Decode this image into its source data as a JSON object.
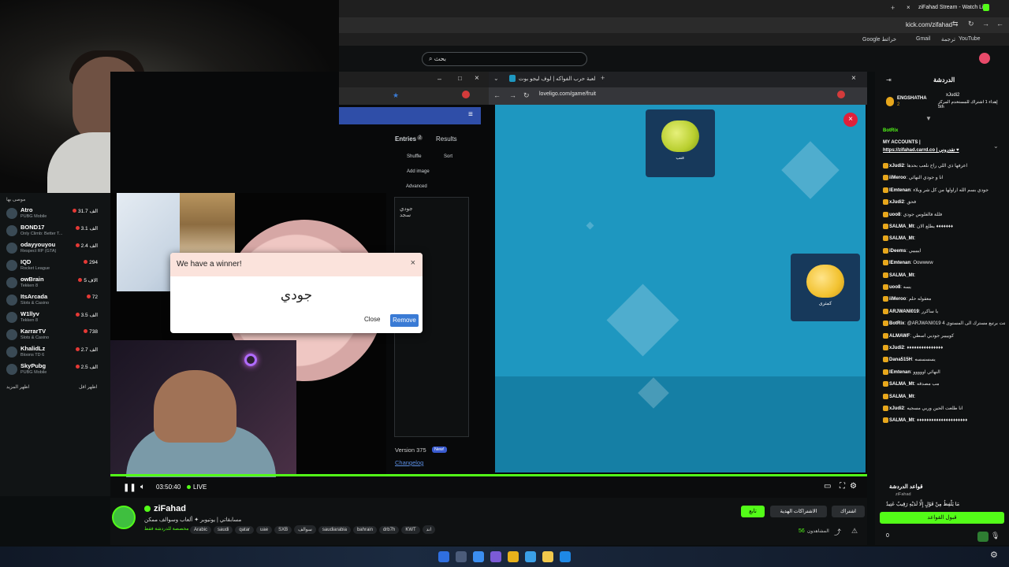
{
  "browser": {
    "tab_title": "ziFahad Stream - Watch Li...",
    "url": "kick.com/zifahad",
    "bookmarks": [
      "Google خرائط",
      "Gmail",
      "ترجمة",
      "YouTube"
    ]
  },
  "kick_header": {
    "search_placeholder": "بحث"
  },
  "left_sidebar": {
    "header": "موصى بها",
    "channels": [
      {
        "name": "Atro",
        "game": "PUBG Mobile",
        "viewers": "31.7 الف"
      },
      {
        "name": "BOND17",
        "game": "Only Climb: Better T...",
        "viewers": "3.1 الف"
      },
      {
        "name": "odayyouyou",
        "game": "Respect RP (GTA)",
        "viewers": "2.4 الف"
      },
      {
        "name": "IQD",
        "game": "Rocket League",
        "viewers": "294"
      },
      {
        "name": "owBrain",
        "game": "Tekken 8",
        "viewers": "5 الاف"
      },
      {
        "name": "ItsArcada",
        "game": "Slots & Casino",
        "viewers": "72"
      },
      {
        "name": "W1llyv",
        "game": "Tekken 8",
        "viewers": "3.5 الف"
      },
      {
        "name": "KarrarTV",
        "game": "Slots & Casino",
        "viewers": "738"
      },
      {
        "name": "KhalidLz",
        "game": "Bloons TD 6",
        "viewers": "2.7 الف"
      },
      {
        "name": "SkyPubg",
        "game": "PUBG Mobile",
        "viewers": "2.5 الف"
      }
    ],
    "show_more": "اظهر المزيد",
    "show_less": "اظهر اقل"
  },
  "wheel_app": {
    "dialog_title": "We have a winner!",
    "winner": "جودي",
    "close_label": "Close",
    "remove_label": "Remove",
    "entries_tab": "Entries",
    "entries_count": "2",
    "results_tab": "Results",
    "shuffle": "Shuffle",
    "sort": "Sort",
    "add_image": "Add image",
    "advanced": "Advanced",
    "entry_1": "جودي",
    "entry_2": "سجد",
    "version": "Version 375",
    "new_badge": "New!",
    "changelog": "Changelog"
  },
  "game_window": {
    "tab_title": "لعبة حرب الفواكه | لوف ليجو بوت",
    "url": "loveligo.com/game/fruit",
    "card_1_label": "عنب",
    "card_2_label": "كمثرى"
  },
  "player": {
    "time": "03:50:40",
    "live": "LIVE"
  },
  "channel": {
    "name": "ziFahad",
    "title": "مسابقاتي | يوتيوبر ✦ ألعاب وسوالف ممكن",
    "category": "مخصصة للدردشة فقط",
    "tags": [
      "Arabic",
      "saudi",
      "qatar",
      "uae",
      "SXB",
      "سوالف",
      "saudiarabia",
      "bahrain",
      "drb7h",
      "KWT",
      "اند"
    ],
    "follow": "تابع",
    "subscribe": "الاشتراكات الهدية",
    "share": "اشتراك",
    "viewers_label": "المشاهدون",
    "viewers": "56"
  },
  "chat": {
    "title": "الدردشة",
    "pinned_user": "ENGSHATHA",
    "pinned_count": "2",
    "pinned_msg_user": "xJudi2",
    "pinned_msg": "إهداء 1 اشتراك للمستخدم المركز 5th",
    "bot_user": "BotRix",
    "bot_msg_1": "MY ACCOUNTS |",
    "bot_msg_2": "https://zifahad.carrd.co | تقدروني ♥",
    "messages": [
      {
        "user": "xJudi2",
        "text": "اعرفها ذي اللي راح نلعب بحدها"
      },
      {
        "user": "iiMeroo",
        "text": "انا و جودي النهائي"
      },
      {
        "user": "lEmtenan",
        "text": "جودي بسم الله اراولها من كل شر وبلاء"
      },
      {
        "user": "xJudi2",
        "text": "فحق"
      },
      {
        "user": "uoo8",
        "text": "فللة فالغلوس جودي"
      },
      {
        "user": "SALMA_Mt",
        "text": "يطلع الان ♦♦♦♦♦♦♦"
      },
      {
        "user": "SALMA_Mt",
        "text": ""
      },
      {
        "user": "iDeems",
        "text": "ايييييي"
      },
      {
        "user": "lEmtenan",
        "text": "Oowwww"
      },
      {
        "user": "SALMA_Mt",
        "text": ""
      },
      {
        "user": "uoo8",
        "text": "يسه"
      },
      {
        "user": "iiMeroo",
        "text": "معقوله حلم"
      },
      {
        "user": "ARJWANI019",
        "text": "يا ساكرر"
      },
      {
        "user": "BotRix",
        "text": "@ARJWANI019 فتت برتبع مسترك الى المستوى 4"
      },
      {
        "user": "ALMAWF",
        "text": "كويييير جوديي اسطي"
      },
      {
        "user": "xJudi2",
        "text": "♦♦♦♦♦♦♦♦♦♦♦♦♦♦♦"
      },
      {
        "user": "Dana515H",
        "text": "يسسسسه"
      },
      {
        "user": "lEmtenan",
        "text": "النهائي اووووو"
      },
      {
        "user": "SALMA_Mt",
        "text": "مب مصدقه"
      },
      {
        "user": "SALMA_Mt",
        "text": ""
      },
      {
        "user": "xJudi2",
        "text": "انا طلعت الحين وربي مسجيه"
      },
      {
        "user": "SALMA_Mt",
        "text": "♦♦♦♦♦♦♦♦♦♦♦♦♦♦♦♦♦♦♦♦♦"
      }
    ],
    "rules_title": "قواعد الدردشة",
    "rules_user": "ziFahad",
    "rules_text": "مَا يَلْفِظُ مِنْ قَوْلٍ إِلَّا لَدَيْهِ رَقِيبٌ عَتِيدٌ",
    "rules_button": "قبول القواعد",
    "points": "0"
  },
  "colors": {
    "accent": "#53fc18",
    "game_bg": "#1e97c0"
  }
}
